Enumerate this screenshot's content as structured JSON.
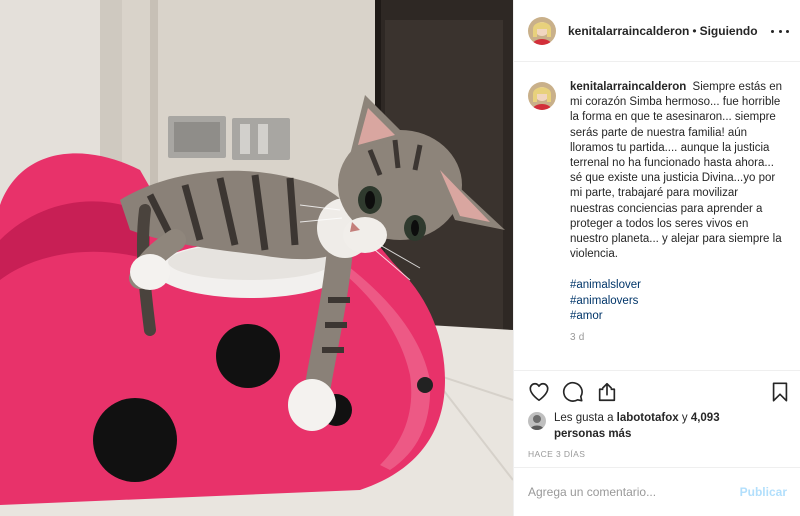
{
  "post": {
    "username": "kenitalarraincalderon",
    "follow_status": "Siguiendo",
    "separator": "•",
    "caption": "Siempre estás en mi corazón Simba hermoso... fue horrible la forma en que te asesinaron... siempre serás parte de nuestra familia! aún lloramos tu partida.... aunque la justicia terrenal no ha funcionado hasta ahora... sé que existe una justicia Divina...yo por mi parte, trabajaré para movilizar nuestras conciencias para aprender a proteger a todos los seres vivos en nuestro planeta... y alejar para siempre la violencia.",
    "hashtags": [
      "#animalslover",
      "#animalovers",
      "#amor"
    ],
    "caption_time": "3 d",
    "image_alt": "Gatito atigrado descansando sobre una bacinica rosada con lunares negros"
  },
  "likes": {
    "prefix": "Les gusta a",
    "liker": "labototafox",
    "joiner": "y",
    "count_text": "4,093 personas más"
  },
  "timestamp": "HACE 3 DÍAS",
  "comment_box": {
    "placeholder": "Agrega un comentario...",
    "publish_label": "Publicar"
  },
  "icons": {
    "more": "more-options-icon",
    "like": "heart-icon",
    "comment": "comment-icon",
    "share": "share-icon",
    "save": "bookmark-icon"
  },
  "colors": {
    "hashtag": "#003569",
    "muted": "#999999",
    "publish_disabled": "#b2dffc",
    "potty_pink": "#e8326a"
  }
}
